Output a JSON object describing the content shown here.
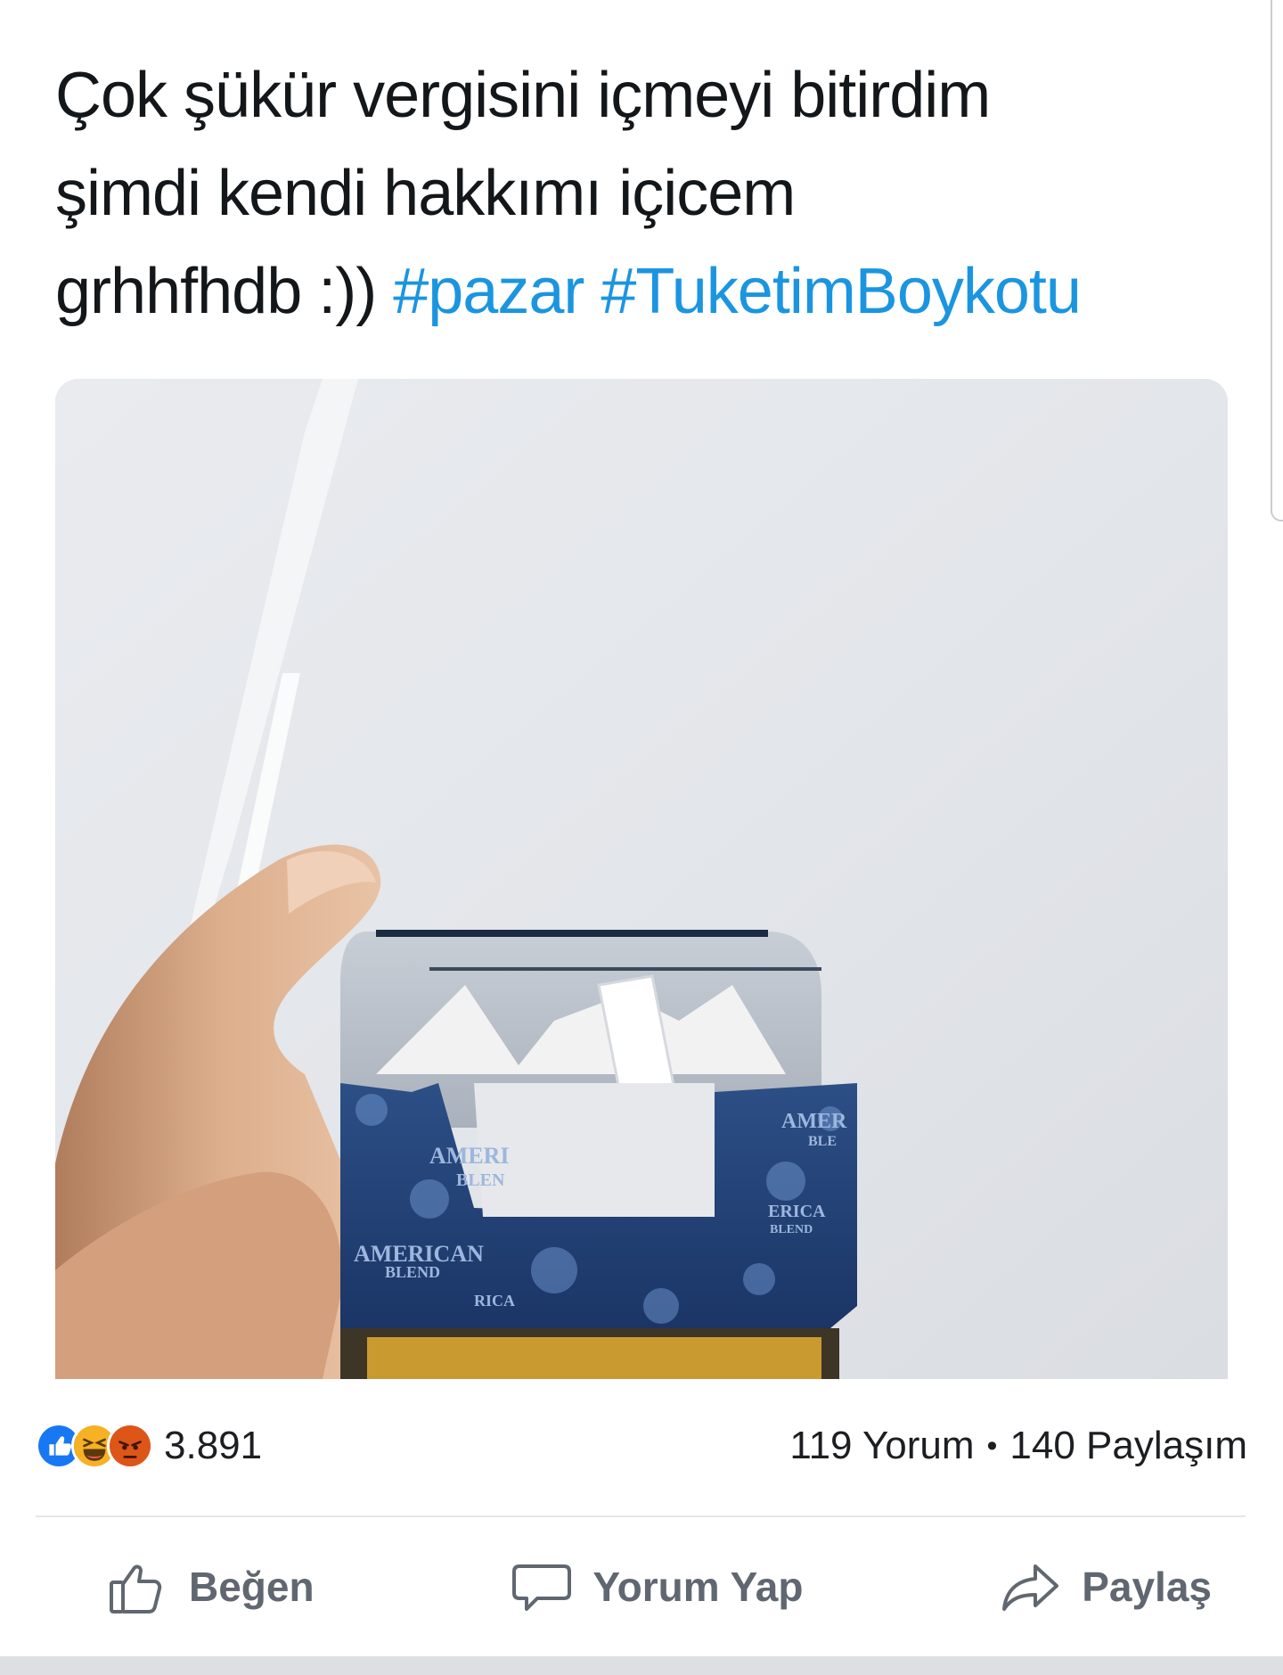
{
  "post": {
    "text_lines": [
      "Çok şükür vergisini içmeyi bitirdim",
      "şimdi kendi hakkımı içicem"
    ],
    "last_line_text": "grhhfhdb :)) ",
    "hashtags": [
      "#pazar",
      "#TuketimBoykotu"
    ],
    "image_text": {
      "brand_top": "AMERI",
      "brand_sub": "BLEN",
      "brand_left": "AMERICAN",
      "brand_left_sub": "BLEND",
      "brand_right": "AMER",
      "brand_right_sub": "BLE",
      "rica": "RICA",
      "erica": "ERICA",
      "blend_small": "BLEND"
    }
  },
  "stats": {
    "reactions": [
      "like-icon",
      "haha-icon",
      "angry-icon"
    ],
    "reaction_count": "3.891",
    "comments": "119 Yorum",
    "separator": "•",
    "shares": "140 Paylaşım"
  },
  "actions": {
    "like_label": "Beğen",
    "comment_label": "Yorum Yap",
    "share_label": "Paylaş"
  },
  "colors": {
    "hashtag": "#1b95e0",
    "like_blue": "#1877f2",
    "haha_yellow": "#f7b125",
    "angry_orange": "#e9710f",
    "action_gray": "#606770"
  }
}
